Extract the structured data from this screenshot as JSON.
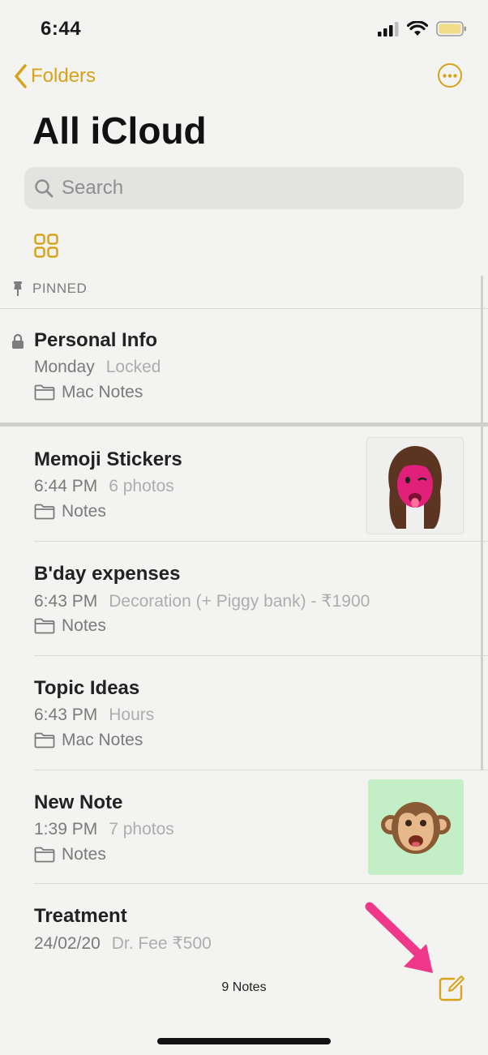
{
  "status": {
    "time": "6:44"
  },
  "nav": {
    "back_label": "Folders",
    "title": "All iCloud"
  },
  "search": {
    "placeholder": "Search"
  },
  "pinned_label": "PINNED",
  "pinned_note": {
    "title": "Personal Info",
    "date": "Monday",
    "preview": "Locked",
    "folder": "Mac Notes"
  },
  "notes": [
    {
      "title": "Memoji Stickers",
      "date": "6:44 PM",
      "preview": "6 photos",
      "folder": "Notes"
    },
    {
      "title": "B'day expenses",
      "date": "6:43 PM",
      "preview": "Decoration (+ Piggy bank) - ₹1900",
      "folder": "Notes"
    },
    {
      "title": "Topic Ideas",
      "date": "6:43 PM",
      "preview": "Hours",
      "folder": "Mac Notes"
    },
    {
      "title": "New Note",
      "date": "1:39 PM",
      "preview": "7 photos",
      "folder": "Notes"
    },
    {
      "title": "Treatment",
      "date": "24/02/20",
      "preview": "Dr. Fee ₹500"
    }
  ],
  "footer": {
    "count": "9 Notes"
  },
  "colors": {
    "accent": "#d9a21b",
    "arrow": "#f0388a",
    "background": "#f3f3f1"
  }
}
